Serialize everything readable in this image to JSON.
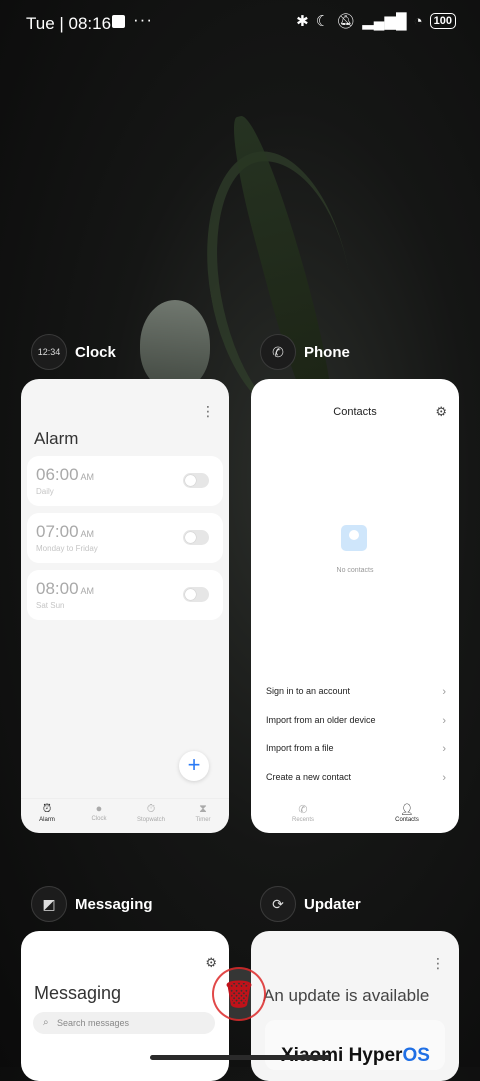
{
  "status_bar": {
    "time": "Tue | 08:16",
    "dots": "···",
    "icons": [
      "bluetooth-icon",
      "moon-icon",
      "bell-off-icon",
      "signal-icon",
      "wifi-icon"
    ],
    "battery": "100"
  },
  "clock": {
    "app_name": "Clock",
    "icon_text": "12:34",
    "title": "Alarm",
    "alarms": [
      {
        "time": "06:00",
        "ampm": "AM",
        "repeat": "Daily"
      },
      {
        "time": "07:00",
        "ampm": "AM",
        "repeat": "Monday to Friday"
      },
      {
        "time": "08:00",
        "ampm": "AM",
        "repeat": "Sat Sun"
      }
    ],
    "fab": "+",
    "tabs": [
      "Alarm",
      "Clock",
      "Stopwatch",
      "Timer"
    ]
  },
  "phone": {
    "app_name": "Phone",
    "title": "Contacts",
    "empty": "No contacts",
    "options": [
      "Sign in to an account",
      "Import from an older device",
      "Import from a file",
      "Create a new contact"
    ],
    "tabs": [
      "Recents",
      "Contacts"
    ]
  },
  "messaging": {
    "app_name": "Messaging",
    "title": "Messaging",
    "search_placeholder": "Search messages"
  },
  "updater": {
    "app_name": "Updater",
    "title": "An update is available",
    "brand": "Xiaomi Hyper",
    "brand_os": "OS"
  },
  "colors": {
    "accent": "#2a7af5",
    "clear": "#c1121a"
  }
}
